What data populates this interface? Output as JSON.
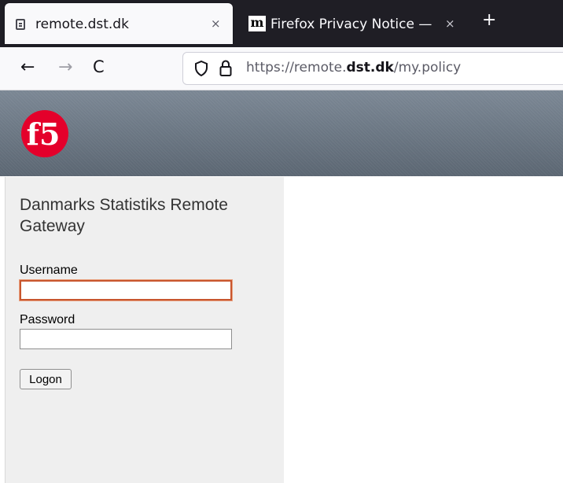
{
  "browser": {
    "tabs": [
      {
        "title": "remote.dst.dk",
        "active": true,
        "icon": "page-icon"
      },
      {
        "title": "Firefox Privacy Notice —",
        "active": false,
        "icon": "mozilla-m-icon"
      }
    ],
    "close_glyph": "×",
    "new_tab_glyph": "+",
    "nav": {
      "back": "←",
      "forward": "→",
      "reload": "C"
    },
    "url": {
      "prefix": "https://remote.",
      "domain": "dst.dk",
      "path": "/my.policy"
    }
  },
  "banner": {
    "logo_text": "f5",
    "logo_color": "#e4002b",
    "background": "#6b7682"
  },
  "login": {
    "title": "Danmarks Statistiks Remote Gateway",
    "username_label": "Username",
    "username_value": "",
    "password_label": "Password",
    "password_value": "",
    "logon_button": "Logon",
    "focus_color": "#c8562e"
  }
}
